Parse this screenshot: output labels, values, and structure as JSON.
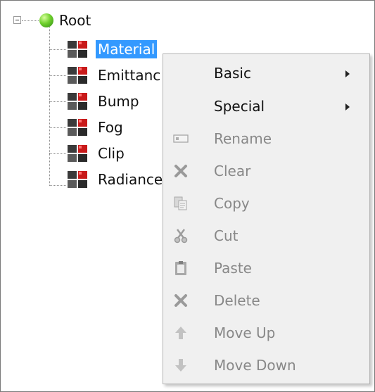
{
  "tree": {
    "root": {
      "label": "Root",
      "icon": "green-ball-icon",
      "expanded": true
    },
    "children": [
      {
        "label": "Material",
        "icon": "material-icon",
        "selected": true
      },
      {
        "label": "Emittanc",
        "icon": "material-icon"
      },
      {
        "label": "Bump",
        "icon": "material-icon"
      },
      {
        "label": "Fog",
        "icon": "material-icon"
      },
      {
        "label": "Clip",
        "icon": "material-icon"
      },
      {
        "label": "Radiance",
        "icon": "material-icon"
      }
    ]
  },
  "context_menu": {
    "items": [
      {
        "label": "Basic",
        "enabled": true,
        "submenu": true
      },
      {
        "label": "Special",
        "enabled": true,
        "submenu": true
      },
      {
        "label": "Rename",
        "enabled": false,
        "icon": "rename-icon"
      },
      {
        "label": "Clear",
        "enabled": false,
        "icon": "clear-x-icon"
      },
      {
        "label": "Copy",
        "enabled": false,
        "icon": "copy-icon"
      },
      {
        "label": "Cut",
        "enabled": false,
        "icon": "scissors-icon"
      },
      {
        "label": "Paste",
        "enabled": false,
        "icon": "paste-icon"
      },
      {
        "label": "Delete",
        "enabled": false,
        "icon": "delete-x-icon"
      },
      {
        "label": "Move Up",
        "enabled": false,
        "icon": "arrow-up-icon"
      },
      {
        "label": "Move Down",
        "enabled": false,
        "icon": "arrow-down-icon"
      }
    ]
  },
  "colors": {
    "selection": "#3399ff",
    "menu_background": "#f0f0f0",
    "disabled_text": "#888888",
    "material_red": "#c81a1a"
  }
}
